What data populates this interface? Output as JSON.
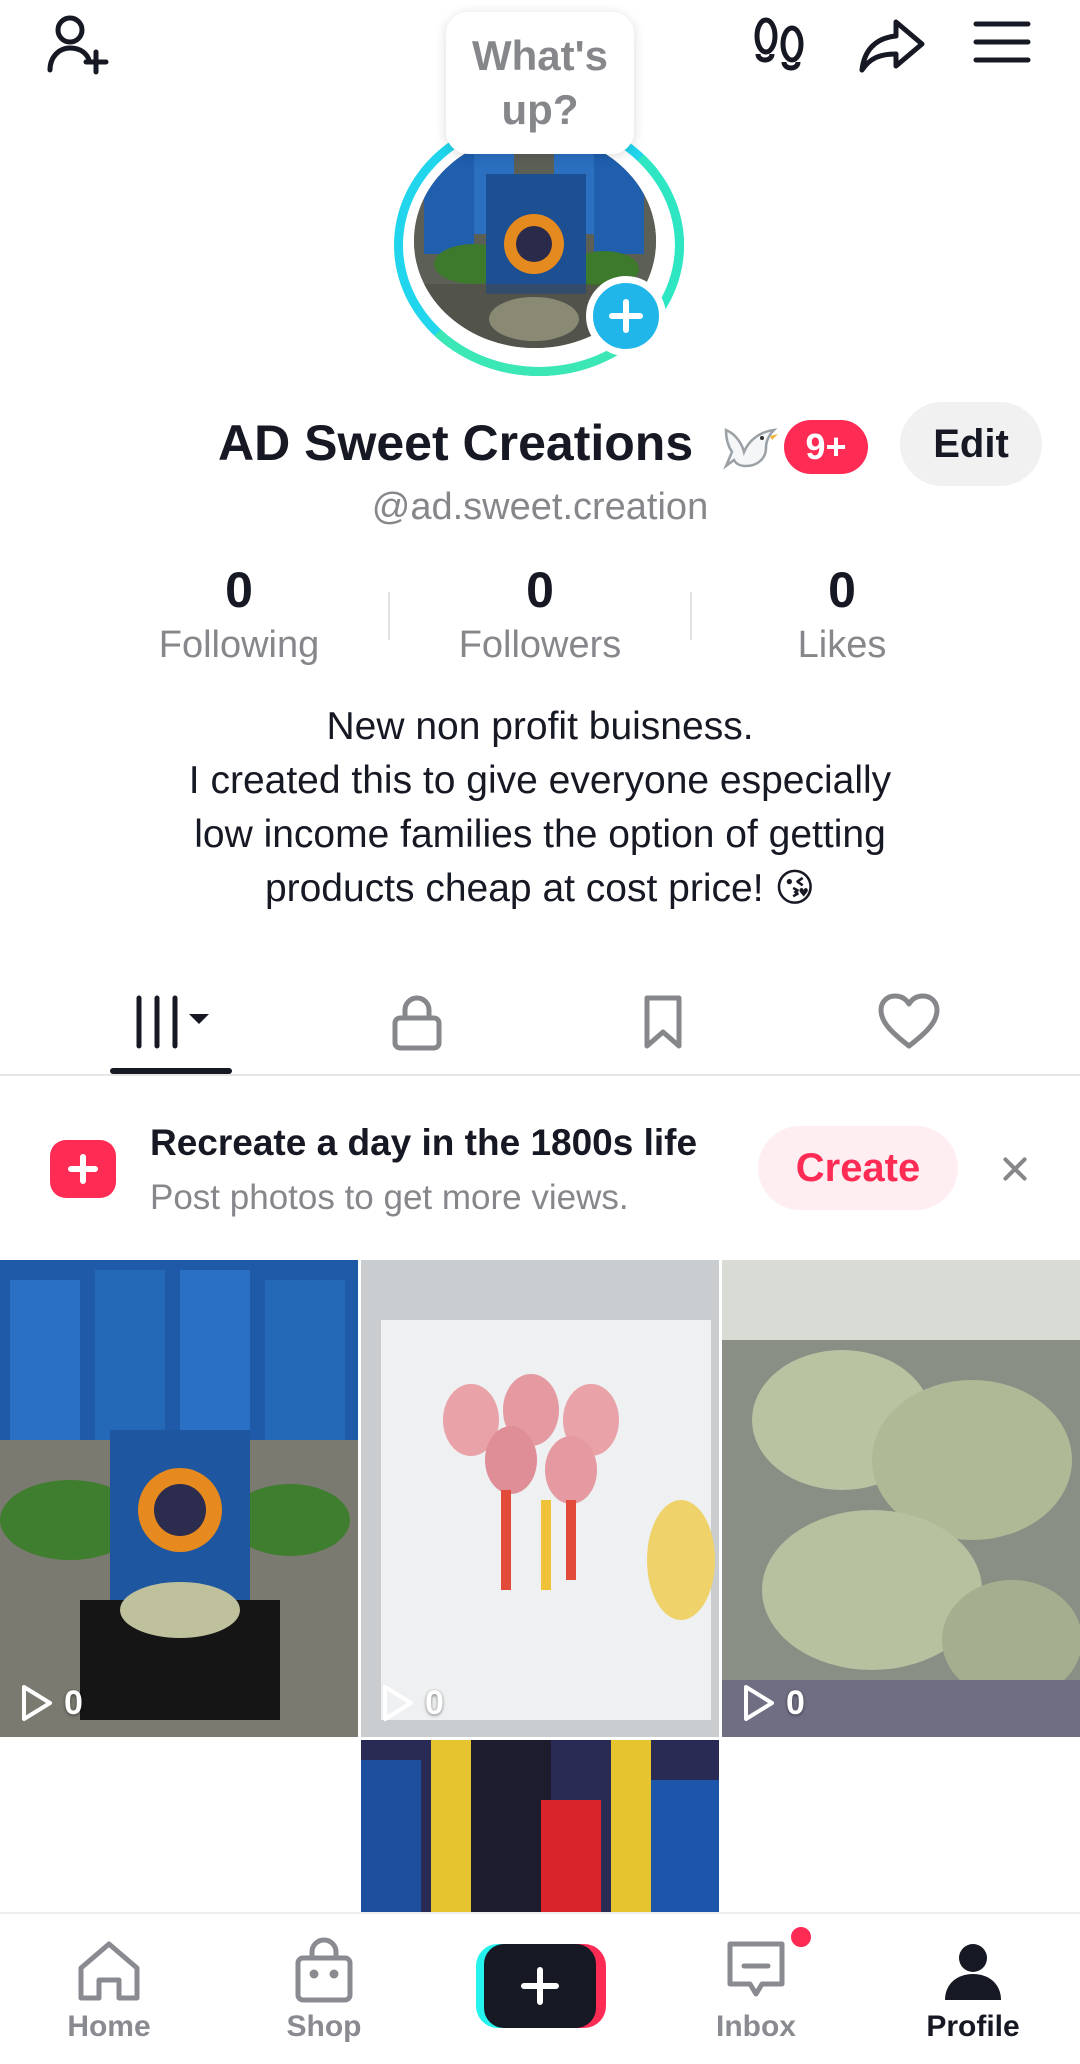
{
  "header": {
    "bubble_text": "What's up?",
    "display_name": "AD Sweet Creations",
    "notification_badge": "9+",
    "edit_label": "Edit",
    "username": "@ad.sweet.creation",
    "icons": [
      "add-friend-icon",
      "footprints-icon",
      "share-icon",
      "menu-icon"
    ]
  },
  "stats": [
    {
      "value": "0",
      "label": "Following"
    },
    {
      "value": "0",
      "label": "Followers"
    },
    {
      "value": "0",
      "label": "Likes"
    }
  ],
  "bio": {
    "line1": "New non profit buisness.",
    "line2": "I created this to give everyone especially",
    "line3": "low income families the option of getting",
    "line4": "products cheap at cost price! 😘"
  },
  "tabs": [
    "videos-grid-icon",
    "private-lock-icon",
    "favorites-bookmark-icon",
    "liked-heart-icon"
  ],
  "promo": {
    "title": "Recreate a day in the 1800s life",
    "subtitle": "Post photos to get more views.",
    "create_label": "Create"
  },
  "videos": [
    {
      "views": "0"
    },
    {
      "views": "0"
    },
    {
      "views": "0"
    }
  ],
  "nav": {
    "home": "Home",
    "shop": "Shop",
    "inbox": "Inbox",
    "profile": "Profile"
  },
  "colors": {
    "accent": "#fe2c55",
    "ring": "#20d5ec",
    "text": "#161823",
    "muted": "#86878b"
  }
}
